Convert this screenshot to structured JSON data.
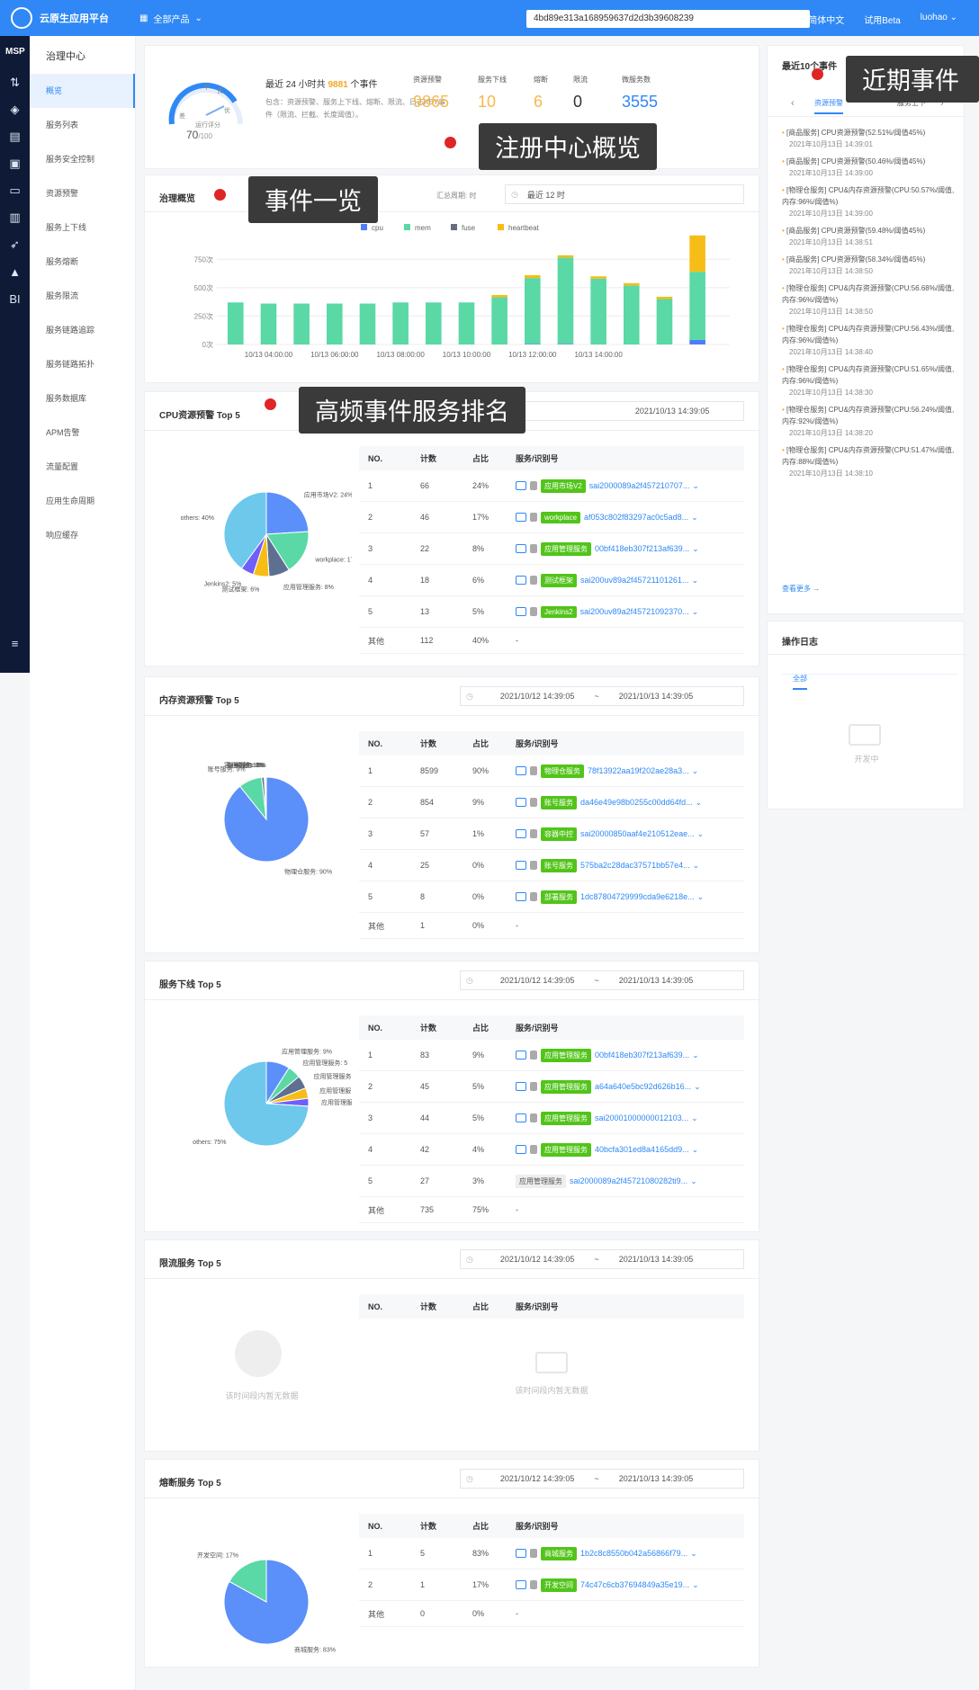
{
  "topbar": {
    "brand": "云原生应用平台",
    "products": "全部产品",
    "search": "4bd89e313a168959637d2d3b39608239",
    "lang": "简体中文",
    "trial": "试用Beta",
    "user": "luohao"
  },
  "rail": {
    "msp": "MSP",
    "bi": "BI"
  },
  "menu": {
    "title": "治理中心",
    "items": [
      "概览",
      "服务列表",
      "服务安全控制",
      "资源预警",
      "服务上下线",
      "服务熔断",
      "服务限流",
      "服务链路追踪",
      "服务链路拓扑",
      "服务数据库",
      "APM告警",
      "流量配置",
      "应用生命周期",
      "响应缓存"
    ]
  },
  "overview": {
    "gauge_low": "差",
    "gauge_mid": "中",
    "gauge_good": "良",
    "gauge_high": "优",
    "gauge_label": "运行评分",
    "score": "70",
    "score_max": "/100",
    "headline_pre": "最近 24 小时共",
    "headline_count": "9881",
    "headline_post": "个事件",
    "desc": "包含：资源预警、服务上下线、熔断、限流、日志KEY事件（限流、拦截、长度阈值）。",
    "stats": [
      {
        "label": "资源预警",
        "value": "9865",
        "color": "#f5b84a"
      },
      {
        "label": "服务下线",
        "value": "10",
        "color": "#f5b84a"
      },
      {
        "label": "熔断",
        "value": "6",
        "color": "#f5b84a"
      },
      {
        "label": "限流",
        "value": "0",
        "color": "#333333"
      },
      {
        "label": "微服务数",
        "value": "3555",
        "color": "#2f88f5"
      }
    ]
  },
  "governance": {
    "title": "治理概览",
    "period_label": "汇总周期:",
    "period_unit": "时",
    "period_value": "最近 12 时"
  },
  "chart_data": {
    "type": "bar",
    "stacked": true,
    "legend_position": "top",
    "series": [
      {
        "name": "cpu",
        "color": "#4d7ef7",
        "values": [
          0,
          0,
          0,
          0,
          0,
          0,
          0,
          0,
          0,
          5,
          5,
          0,
          0,
          0,
          40
        ]
      },
      {
        "name": "mem",
        "color": "#5ad8a6",
        "values": [
          370,
          360,
          360,
          360,
          360,
          370,
          370,
          370,
          415,
          580,
          760,
          580,
          520,
          400,
          600
        ]
      },
      {
        "name": "fuse",
        "color": "#666f7f",
        "values": [
          0,
          0,
          0,
          0,
          0,
          0,
          0,
          0,
          0,
          0,
          0,
          0,
          0,
          0,
          0
        ]
      },
      {
        "name": "heartbeat",
        "color": "#f6bd16",
        "values": [
          0,
          0,
          0,
          0,
          0,
          0,
          0,
          0,
          20,
          25,
          20,
          20,
          20,
          20,
          320
        ]
      }
    ],
    "ylim": [
      0,
      950
    ],
    "yticks": [
      0,
      250,
      500,
      750
    ],
    "ytick_labels": [
      "0次",
      "250次",
      "500次",
      "750次"
    ],
    "xtick_labels": [
      "10/13 04:00:00",
      "10/13 06:00:00",
      "10/13 08:00:00",
      "10/13 10:00:00",
      "10/13 12:00:00",
      "10/13 14:00:00"
    ],
    "grid": true
  },
  "panels": [
    {
      "title": "CPU资源预警 Top 5",
      "range_start": "",
      "range_sep": "",
      "range_end": "2021/10/13 14:39:05",
      "headers": [
        "NO.",
        "计数",
        "占比",
        "服务/识别号"
      ],
      "rows": [
        {
          "no": "1",
          "count": "66",
          "pct": "24%",
          "tag": "应用市场V2",
          "hash": "sai2000089a2f457210707..."
        },
        {
          "no": "2",
          "count": "46",
          "pct": "17%",
          "tag": "workplace",
          "hash": "af053c802f83297ac0c5ad8..."
        },
        {
          "no": "3",
          "count": "22",
          "pct": "8%",
          "tag": "应用管理服务",
          "hash": "00bf418eb307f213af639..."
        },
        {
          "no": "4",
          "count": "18",
          "pct": "6%",
          "tag": "测试框架",
          "hash": "sai200uv89a2f45721101261..."
        },
        {
          "no": "5",
          "count": "13",
          "pct": "5%",
          "tag": "Jenkins2",
          "hash": "sai200uv89a2f45721092370..."
        }
      ],
      "other": {
        "label": "其他",
        "count": "112",
        "pct": "40%",
        "rest": "-"
      },
      "pie": [
        {
          "label": "应用市场V2: 24%",
          "value": 24,
          "color": "#5b8ff9"
        },
        {
          "label": "workplace: 17%",
          "value": 17,
          "color": "#5ad8a6"
        },
        {
          "label": "应用管理服务: 8%",
          "value": 8,
          "color": "#5d7092"
        },
        {
          "label": "测试框架: 6%",
          "value": 6,
          "color": "#f6bd16"
        },
        {
          "label": "Jenkins2: 5%",
          "value": 5,
          "color": "#6f5ef9"
        },
        {
          "label": "others: 40%",
          "value": 40,
          "color": "#6dc8ec"
        }
      ]
    },
    {
      "title": "内存资源预警 Top 5",
      "range_start": "2021/10/12 14:39:05",
      "range_sep": "~",
      "range_end": "2021/10/13 14:39:05",
      "headers": [
        "NO.",
        "计数",
        "占比",
        "服务/识别号"
      ],
      "rows": [
        {
          "no": "1",
          "count": "8599",
          "pct": "90%",
          "tag": "物理仓服务",
          "hash": "78f13922aa19f202ae28a3..."
        },
        {
          "no": "2",
          "count": "854",
          "pct": "9%",
          "tag": "账号服务",
          "hash": "da46e49e98b0255c00dd64fd..."
        },
        {
          "no": "3",
          "count": "57",
          "pct": "1%",
          "tag": "容器中控",
          "hash": "sai20000850aaf4e210512eae..."
        },
        {
          "no": "4",
          "count": "25",
          "pct": "0%",
          "tag": "账号服务",
          "hash": "575ba2c28dac37571bb57e4..."
        },
        {
          "no": "5",
          "count": "8",
          "pct": "0%",
          "tag": "部署服务",
          "hash": "1dc87804729999cda9e6218e..."
        }
      ],
      "other": {
        "label": "其他",
        "count": "1",
        "pct": "0%",
        "rest": "-"
      },
      "pie": [
        {
          "label": "物理仓服务: 90%",
          "value": 90,
          "color": "#5b8ff9"
        },
        {
          "label": "账号服务: 9%",
          "value": 9,
          "color": "#5ad8a6"
        },
        {
          "label": "容器中控: 1%",
          "value": 1,
          "color": "#5d7092"
        },
        {
          "label": "账号服务: 0%",
          "value": 0.3,
          "color": "#f6bd16"
        },
        {
          "label": "部署服务: 0%",
          "value": 0.3,
          "color": "#6f5ef9"
        },
        {
          "label": "others: 0%",
          "value": 0.2,
          "color": "#6dc8ec"
        }
      ]
    },
    {
      "title": "服务下线 Top 5",
      "range_start": "2021/10/12 14:39:05",
      "range_sep": "~",
      "range_end": "2021/10/13 14:39:05",
      "headers": [
        "NO.",
        "计数",
        "占比",
        "服务/识别号"
      ],
      "rows": [
        {
          "no": "1",
          "count": "83",
          "pct": "9%",
          "tag": "应用管理服务",
          "hash": "00bf418eb307f213af639..."
        },
        {
          "no": "2",
          "count": "45",
          "pct": "5%",
          "tag": "应用管理服务",
          "hash": "a64a640e5bc92d626b16..."
        },
        {
          "no": "3",
          "count": "44",
          "pct": "5%",
          "tag": "应用管理服务",
          "hash": "sai20001000000012103..."
        },
        {
          "no": "4",
          "count": "42",
          "pct": "4%",
          "tag": "应用管理服务",
          "hash": "40bcfa301ed8a4165dd9..."
        },
        {
          "no": "5",
          "count": "27",
          "pct": "3%",
          "tag": "应用管理服务",
          "hash": "sai2000089a2f45721080282ti9...",
          "gray": true
        }
      ],
      "other": {
        "label": "其他",
        "count": "735",
        "pct": "75%",
        "rest": "-"
      },
      "pie": [
        {
          "label": "应用管理服务: 9%",
          "value": 9,
          "color": "#5b8ff9"
        },
        {
          "label": "应用管理服务: 5",
          "value": 5,
          "color": "#5ad8a6"
        },
        {
          "label": "应用管理服务",
          "value": 5,
          "color": "#5d7092"
        },
        {
          "label": "应用管理服",
          "value": 4,
          "color": "#f6bd16"
        },
        {
          "label": "应用管理服",
          "value": 3,
          "color": "#6f5ef9"
        },
        {
          "label": "others: 75%",
          "value": 74,
          "color": "#6dc8ec"
        }
      ]
    },
    {
      "title": "限流服务 Top 5",
      "range_start": "2021/10/12 14:39:05",
      "range_sep": "~",
      "range_end": "2021/10/13 14:39:05",
      "headers": [
        "NO.",
        "计数",
        "占比",
        "服务/识别号"
      ],
      "rows": [],
      "empty_pie": "该时间段内暂无数据",
      "empty_table": "该时间段内暂无数据"
    },
    {
      "title": "熔断服务 Top 5",
      "range_start": "2021/10/12 14:39:05",
      "range_sep": "~",
      "range_end": "2021/10/13 14:39:05",
      "headers": [
        "NO.",
        "计数",
        "占比",
        "服务/识别号"
      ],
      "rows": [
        {
          "no": "1",
          "count": "5",
          "pct": "83%",
          "tag": "商城服务",
          "hash": "1b2c8c8550b042a56866f79..."
        },
        {
          "no": "2",
          "count": "1",
          "pct": "17%",
          "tag": "开发空间",
          "hash": "74c47c6cb37694849a35e19..."
        }
      ],
      "other": {
        "label": "其他",
        "count": "0",
        "pct": "0%",
        "rest": "-"
      },
      "pie": [
        {
          "label": "商城服务: 83%",
          "value": 83,
          "color": "#5b8ff9"
        },
        {
          "label": "开发空间: 17%",
          "value": 17,
          "color": "#5ad8a6"
        }
      ]
    }
  ],
  "recent": {
    "title": "最近10个事件",
    "tab_active": "资源预警",
    "tab_next": "服务上下",
    "more": "查看更多 →",
    "events": [
      {
        "text": "[商品服务] CPU资源预警(52.51%/阈值45%)",
        "time": "2021年10月13日 14:39:01"
      },
      {
        "text": "[商品服务] CPU资源预警(50.46%/阈值45%)",
        "time": "2021年10月13日 14:39:00"
      },
      {
        "text": "[物理仓服务] CPU&内存资源预警(CPU:50.57%/阈值, 内存:96%/阈值%)",
        "time": "2021年10月13日 14:39:00"
      },
      {
        "text": "[商品服务] CPU资源预警(59.48%/阈值45%)",
        "time": "2021年10月13日 14:38:51"
      },
      {
        "text": "[商品服务] CPU资源预警(58.34%/阈值45%)",
        "time": "2021年10月13日 14:38:50"
      },
      {
        "text": "[物理仓服务] CPU&内存资源预警(CPU:56.68%/阈值, 内存:96%/阈值%)",
        "time": "2021年10月13日 14:38:50"
      },
      {
        "text": "[物理仓服务] CPU&内存资源预警(CPU:56.43%/阈值, 内存:96%/阈值%)",
        "time": "2021年10月13日 14:38:40"
      },
      {
        "text": "[物理仓服务] CPU&内存资源预警(CPU:51.65%/阈值, 内存:96%/阈值%)",
        "time": "2021年10月13日 14:38:30"
      },
      {
        "text": "[物理仓服务] CPU&内存资源预警(CPU:56.24%/阈值, 内存:92%/阈值%)",
        "time": "2021年10月13日 14:38:20"
      },
      {
        "text": "[物理仓服务] CPU&内存资源预警(CPU:51.47%/阈值, 内存:88%/阈值%)",
        "time": "2021年10月13日 14:38:10"
      }
    ]
  },
  "oplog": {
    "title": "操作日志",
    "tab": "全部",
    "empty": "开发中"
  },
  "callouts": {
    "registry": "注册中心概览",
    "events": "事件一览",
    "ranking": "高频事件服务排名",
    "recent": "近期事件"
  }
}
